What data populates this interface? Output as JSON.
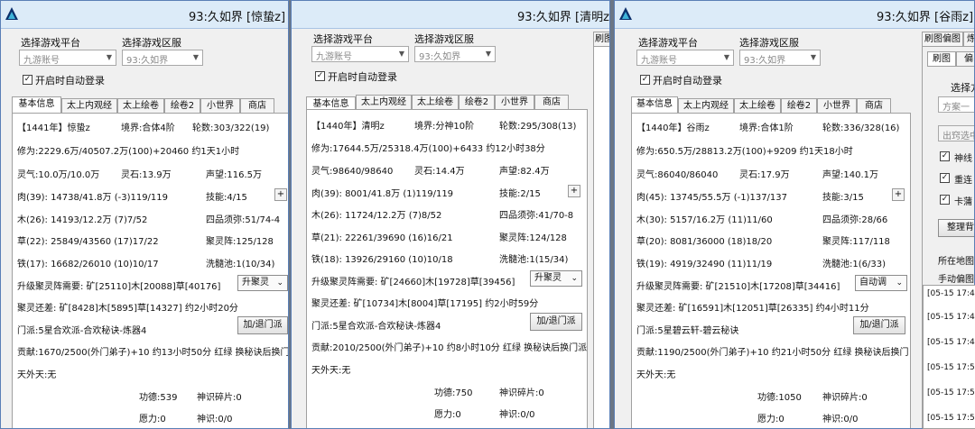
{
  "windows": [
    {
      "title": "93:久如界 [惊蛰z] 转",
      "platform_label": "选择游戏平台",
      "server_label": "选择游戏区服",
      "platform_value": "九游账号",
      "server_value": "93:久如界",
      "autologin_label": "开启时自动登录",
      "tabs": [
        "基本信息",
        "太上内观经",
        "太上绘卷",
        "绘卷2",
        "小世界",
        "商店"
      ],
      "rows": {
        "name": "【1441年】惊蛰z",
        "realm": "境界:合体4阶",
        "round": "轮数:303/322(19)",
        "cultivation": "修为:2229.6万/40507.2万(100)+20460 约1天1小时",
        "lingqi": "灵气:10.0万/10.0万",
        "lingshi": "灵石:13.9万",
        "shengwang": "声望:116.5万",
        "rou": "肉(39): 14738/41.8万 (-3)119/119",
        "jineng": "技能:4/15",
        "mu": "木(26): 14193/12.2万 (7)7/52",
        "sipin": "四品须弥:51/74-4",
        "cao": "草(22): 25849/43560 (17)17/22",
        "juling": "聚灵阵:125/128",
        "tie": "铁(17): 16682/26010 (10)10/17",
        "xisui": "洗髓池:1(10/34)",
        "upgrade": "升级聚灵阵需要: 矿[25110]木[20088]草[40176]",
        "upgrade_select": "升聚灵",
        "still_need": "聚灵还差: 矿[8428]木[5895]草[14327] 约2小时20分",
        "sect": "门派:5星合欢派-合欢秘诀-炼器4",
        "sect_button": "加/退门派",
        "contrib": "贡献:1670/2500(外门弟子)+10 约13小时50分 红绿 换秘诀后换门",
        "tianwai": "天外天:无",
        "gongde": "功德:539",
        "shenshi": "神识碎片:0",
        "yuanli": "愿力:0",
        "shenzhi": "神识:0/0"
      }
    },
    {
      "title": "93:久如界 [清明z] 转",
      "platform_label": "选择游戏平台",
      "server_label": "选择游戏区服",
      "platform_value": "九游账号",
      "server_value": "93:久如界",
      "autologin_label": "开启时自动登录",
      "tabs": [
        "基本信息",
        "太上内观经",
        "太上绘卷",
        "绘卷2",
        "小世界",
        "商店"
      ],
      "side_tab": "刷图",
      "rows": {
        "name": "【1440年】清明z",
        "realm": "境界:分神10阶",
        "round": "轮数:295/308(13)",
        "cultivation": "修为:17644.5万/25318.4万(100)+6433 约12小时38分",
        "lingqi": "灵气:98640/98640",
        "lingshi": "灵石:14.4万",
        "shengwang": "声望:82.4万",
        "rou": "肉(39): 8001/41.8万 (1)119/119",
        "jineng": "技能:2/15",
        "mu": "木(26): 11724/12.2万 (7)8/52",
        "sipin": "四品须弥:41/70-8",
        "cao": "草(21): 22261/39690 (16)16/21",
        "juling": "聚灵阵:124/128",
        "tie": "铁(18): 13926/29160 (10)10/18",
        "xisui": "洗髓池:1(15/34)",
        "upgrade": "升级聚灵阵需要: 矿[24660]木[19728]草[39456]",
        "upgrade_select": "升聚灵",
        "still_need": "聚灵还差: 矿[10734]木[8004]草[17195] 约2小时59分",
        "sect": "门派:5星合欢派-合欢秘诀-炼器4",
        "sect_button": "加/退门派",
        "contrib": "贡献:2010/2500(外门弟子)+10 约8小时10分 红绿 换秘诀后换门派",
        "tianwai": "天外天:无",
        "gongde": "功德:750",
        "shenshi": "神识碎片:0",
        "yuanli": "愿力:0",
        "shenzhi": "神识:0/0"
      }
    },
    {
      "title": "93:久如界 [谷雨z] 转",
      "platform_label": "选择游戏平台",
      "server_label": "选择游戏区服",
      "platform_value": "九游账号",
      "server_value": "93:久如界",
      "autologin_label": "开启时自动登录",
      "tabs": [
        "基本信息",
        "太上内观经",
        "太上绘卷",
        "绘卷2",
        "小世界",
        "商店"
      ],
      "rows": {
        "name": "【1440年】谷雨z",
        "realm": "境界:合体1阶",
        "round": "轮数:336/328(16)",
        "cultivation": "修为:650.5万/28813.2万(100)+9209 约1天18小时",
        "lingqi": "灵气:86040/86040",
        "lingshi": "灵石:17.9万",
        "shengwang": "声望:140.1万",
        "rou": "肉(45): 13745/55.5万 (-1)137/137",
        "jineng": "技能:3/15",
        "mu": "木(30): 5157/16.2万 (11)11/60",
        "sipin": "四品须弥:28/66",
        "cao": "草(20): 8081/36000 (18)18/20",
        "juling": "聚灵阵:117/118",
        "tie": "铁(19): 4919/32490 (11)11/19",
        "xisui": "洗髓池:1(6/33)",
        "upgrade": "升级聚灵阵需要: 矿[21510]木[17208]草[34416]",
        "upgrade_select": "自动调",
        "still_need": "聚灵还差: 矿[16591]木[12051]草[26335] 约4小时11分",
        "sect": "门派:5星碧云轩-碧云秘诀",
        "sect_button": "加/退门派",
        "contrib": "贡献:1190/2500(外门弟子)+10 约21小时50分 红绿 换秘诀后换门",
        "tianwai": "天外天:无",
        "gongde": "功德:1050",
        "shenshi": "神识碎片:0",
        "yuanli": "愿力:0",
        "shenzhi": "神识:0/0"
      }
    }
  ],
  "right_panel": {
    "tabs": [
      "刷图偏图",
      "炼"
    ],
    "subtabs": [
      "刷图",
      "偏"
    ],
    "choose_label": "选择方",
    "scheme_placeholder": "方案一",
    "dropdown": "出窍选中",
    "checks": [
      "神线",
      "重连",
      "卡蒲"
    ],
    "organize_button": "整理背",
    "map_label": "所在地图",
    "manual_label": "手动偏图",
    "log_lines": [
      "[05-15 17:4",
      "[05-15 17:4",
      "[05-15 17:4",
      "[05-15 17:5",
      "[05-15 17:5",
      "[05-15 17:5"
    ]
  }
}
